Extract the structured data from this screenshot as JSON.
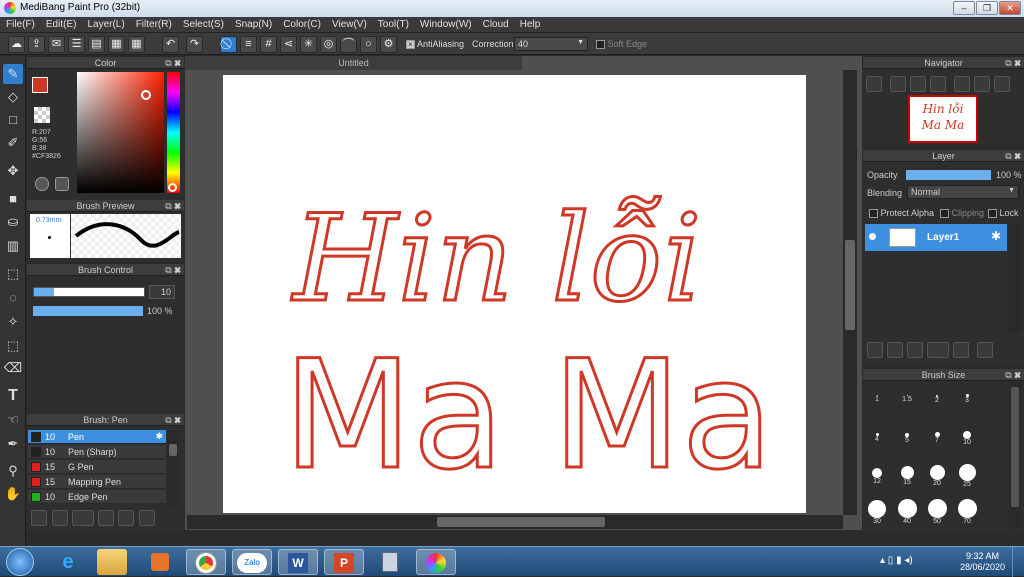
{
  "window": {
    "title": "MediBang Paint Pro (32bit)"
  },
  "menu": [
    "File(F)",
    "Edit(E)",
    "Layer(L)",
    "Filter(R)",
    "Select(S)",
    "Snap(N)",
    "Color(C)",
    "View(V)",
    "Tool(T)",
    "Window(W)",
    "Cloud",
    "Help"
  ],
  "toolbar": {
    "antialiasing_label": "AntiAliasing",
    "correction_label": "Correction",
    "correction_value": "40",
    "soft_edge_label": "Soft Edge"
  },
  "color_panel": {
    "title": "Color",
    "r": "R:207",
    "g": "G:56",
    "b": "B:38",
    "hex": "#CF3826",
    "primary": "#cf3826"
  },
  "brush_preview": {
    "title": "Brush Preview",
    "size": "0.73mm"
  },
  "brush_control": {
    "title": "Brush Control",
    "size_value": "10",
    "opacity_value": "100 %"
  },
  "brush_list": {
    "title": "Brush: Pen",
    "items": [
      {
        "size": "10",
        "name": "Pen",
        "color": "#222222"
      },
      {
        "size": "10",
        "name": "Pen (Sharp)",
        "color": "#222222"
      },
      {
        "size": "15",
        "name": "G Pen",
        "color": "#e02020"
      },
      {
        "size": "15",
        "name": "Mapping Pen",
        "color": "#e02020"
      },
      {
        "size": "10",
        "name": "Edge Pen",
        "color": "#20b020"
      }
    ]
  },
  "document": {
    "tab": "Untitled",
    "line1": "Hin lỗi",
    "line2": "Ma Ma",
    "ink": "#cf3826"
  },
  "navigator": {
    "title": "Navigator",
    "thumb_line1": "Hin lỗi",
    "thumb_line2": "Ma Ma"
  },
  "layer_panel": {
    "title": "Layer",
    "opacity_label": "Opacity",
    "opacity_value": "100 %",
    "blending_label": "Blending",
    "blending_value": "Normal",
    "protect_alpha": "Protect Alpha",
    "clipping": "Clipping",
    "lock": "Lock",
    "layer_name": "Layer1"
  },
  "brush_size": {
    "title": "Brush Size",
    "sizes": [
      "1",
      "1.5",
      "2",
      "3",
      "4",
      "5",
      "7",
      "10",
      "12",
      "15",
      "20",
      "25",
      "30",
      "40",
      "50",
      "70"
    ]
  },
  "taskbar": {
    "time": "9:32 AM",
    "date": "28/06/2020",
    "zalo": "Zalo"
  }
}
